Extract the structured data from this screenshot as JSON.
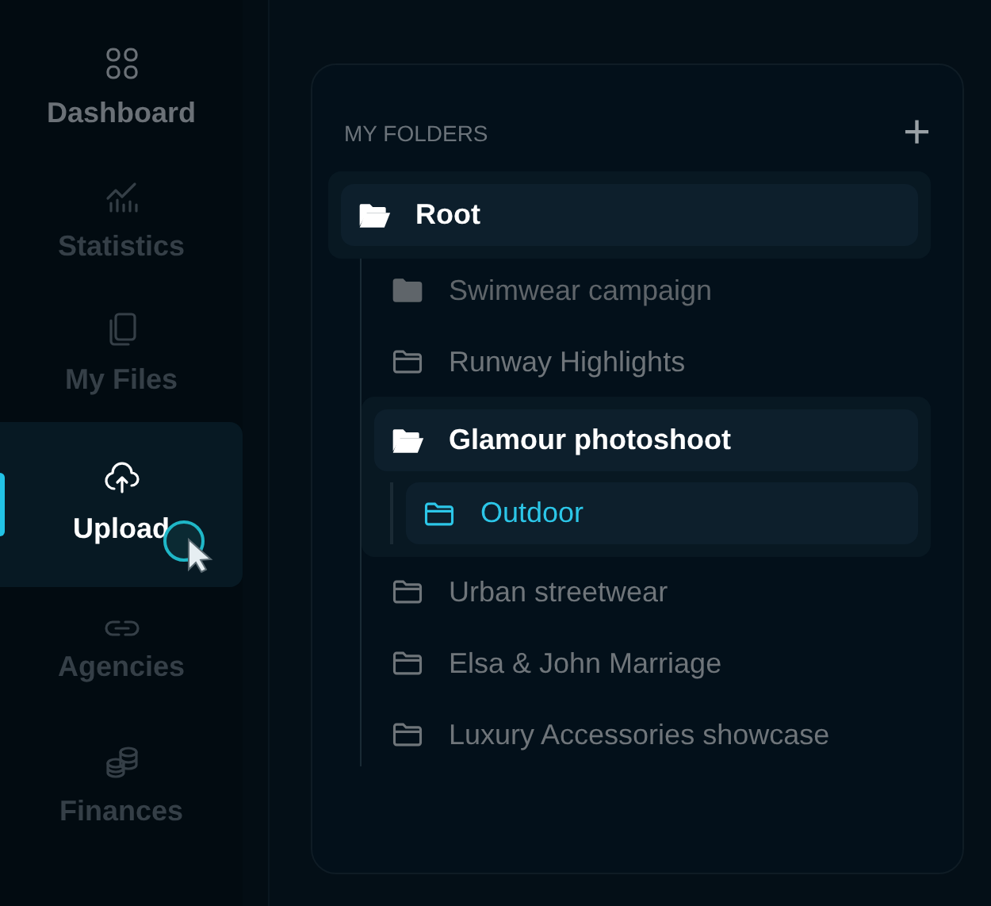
{
  "sidebar": {
    "items": [
      {
        "label": "Dashboard",
        "kind": "grid",
        "selected": false,
        "dimmed": false
      },
      {
        "label": "Statistics",
        "kind": "chart",
        "selected": false,
        "dimmed": true
      },
      {
        "label": "My Files",
        "kind": "files",
        "selected": false,
        "dimmed": true
      },
      {
        "label": "Upload",
        "kind": "upload",
        "selected": true,
        "dimmed": false
      },
      {
        "label": "Agencies",
        "kind": "link",
        "selected": false,
        "dimmed": true
      },
      {
        "label": "Finances",
        "kind": "coins",
        "selected": false,
        "dimmed": true
      }
    ]
  },
  "folders": {
    "title": "MY FOLDERS",
    "add_label": "+",
    "tree": [
      {
        "label": "Root",
        "kind": "open",
        "expanded": true,
        "selected": false,
        "children": [
          {
            "label": "Swimwear campaign",
            "kind": "filled",
            "expanded": false,
            "selected": false
          },
          {
            "label": "Runway Highlights",
            "kind": "outline",
            "expanded": false,
            "selected": false
          },
          {
            "label": "Glamour photoshoot",
            "kind": "open",
            "expanded": true,
            "selected": false,
            "children": [
              {
                "label": "Outdoor",
                "kind": "outline",
                "expanded": false,
                "selected": true
              }
            ]
          },
          {
            "label": "Urban streetwear",
            "kind": "outline",
            "expanded": false,
            "selected": false
          },
          {
            "label": "Elsa & John Marriage",
            "kind": "outline",
            "expanded": false,
            "selected": false
          },
          {
            "label": "Luxury Accessories showcase",
            "kind": "outline",
            "expanded": false,
            "selected": false
          }
        ]
      }
    ]
  }
}
